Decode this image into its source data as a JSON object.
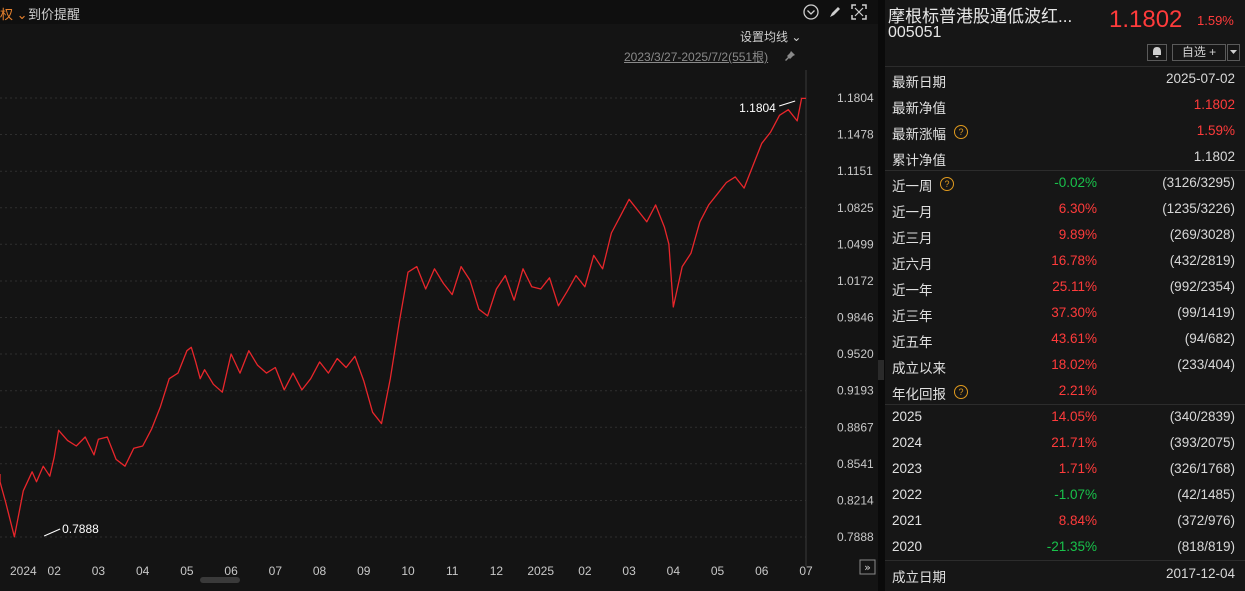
{
  "toolbar": {
    "left_fragment": "权",
    "price_alert": "到价提醒",
    "ma_setting": "设置均线",
    "range": "2023/3/27-2025/7/2(551根)"
  },
  "fund": {
    "name": "摩根标普港股通低波红...",
    "code": "005051",
    "nav": "1.1802",
    "change": "1.59%",
    "watch_label": "自选 +"
  },
  "basic_info": [
    {
      "label": "最新日期",
      "value": "2025-07-02",
      "color": "neutral"
    },
    {
      "label": "最新净值",
      "value": "1.1802",
      "color": "up"
    },
    {
      "label": "最新涨幅",
      "value": "1.59%",
      "color": "up",
      "help": true
    },
    {
      "label": "累计净值",
      "value": "1.1802",
      "color": "neutral"
    }
  ],
  "period_returns": [
    {
      "label": "近一周",
      "pct": "-0.02%",
      "rank": "(3126/3295)",
      "color": "down",
      "help": true
    },
    {
      "label": "近一月",
      "pct": "6.30%",
      "rank": "(1235/3226)",
      "color": "up"
    },
    {
      "label": "近三月",
      "pct": "9.89%",
      "rank": "(269/3028)",
      "color": "up"
    },
    {
      "label": "近六月",
      "pct": "16.78%",
      "rank": "(432/2819)",
      "color": "up"
    },
    {
      "label": "近一年",
      "pct": "25.11%",
      "rank": "(992/2354)",
      "color": "up"
    },
    {
      "label": "近三年",
      "pct": "37.30%",
      "rank": "(99/1419)",
      "color": "up"
    },
    {
      "label": "近五年",
      "pct": "43.61%",
      "rank": "(94/682)",
      "color": "up"
    },
    {
      "label": "成立以来",
      "pct": "18.02%",
      "rank": "(233/404)",
      "color": "up"
    },
    {
      "label": "年化回报",
      "pct": "2.21%",
      "rank": "",
      "color": "up",
      "help": true
    }
  ],
  "yearly_returns": [
    {
      "label": "2025",
      "pct": "14.05%",
      "rank": "(340/2839)",
      "color": "up"
    },
    {
      "label": "2024",
      "pct": "21.71%",
      "rank": "(393/2075)",
      "color": "up"
    },
    {
      "label": "2023",
      "pct": "1.71%",
      "rank": "(326/1768)",
      "color": "up"
    },
    {
      "label": "2022",
      "pct": "-1.07%",
      "rank": "(42/1485)",
      "color": "down"
    },
    {
      "label": "2021",
      "pct": "8.84%",
      "rank": "(372/976)",
      "color": "up"
    },
    {
      "label": "2020",
      "pct": "-21.35%",
      "rank": "(818/819)",
      "color": "down"
    }
  ],
  "inception": {
    "label": "成立日期",
    "value": "2017-12-04"
  },
  "colors": {
    "up": "#ff3b3b",
    "down": "#19c24b",
    "line": "#e8262b",
    "grid": "#2e2e2e",
    "text": "#d8d8d8"
  },
  "chart_data": {
    "type": "line",
    "title": "",
    "xlabel": "",
    "ylabel": "",
    "ylim": [
      0.7888,
      1.1804
    ],
    "y_ticks": [
      "1.1804",
      "1.1478",
      "1.1151",
      "1.0825",
      "1.0499",
      "1.0172",
      "0.9846",
      "0.9520",
      "0.9193",
      "0.8867",
      "0.8541",
      "0.8214",
      "0.7888"
    ],
    "x_ticks": [
      {
        "label": "2024",
        "x": 0
      },
      {
        "label": "02",
        "x": 1
      },
      {
        "label": "03",
        "x": 2
      },
      {
        "label": "04",
        "x": 3
      },
      {
        "label": "05",
        "x": 4
      },
      {
        "label": "06",
        "x": 5
      },
      {
        "label": "07",
        "x": 6
      },
      {
        "label": "08",
        "x": 7
      },
      {
        "label": "09",
        "x": 8
      },
      {
        "label": "10",
        "x": 9
      },
      {
        "label": "11",
        "x": 10
      },
      {
        "label": "12",
        "x": 11
      },
      {
        "label": "2025",
        "x": 12
      },
      {
        "label": "02",
        "x": 13
      },
      {
        "label": "03",
        "x": 14
      },
      {
        "label": "04",
        "x": 15
      },
      {
        "label": "05",
        "x": 16
      },
      {
        "label": "06",
        "x": 17
      },
      {
        "label": "07",
        "x": 18
      }
    ],
    "annotations": [
      {
        "text": "0.7888",
        "x": 0.5,
        "y": 0.7888
      },
      {
        "text": "1.1804",
        "x": 17.8,
        "y": 1.1804
      }
    ],
    "series": [
      {
        "color": "#e8262b",
        "x": [
          -0.5,
          -0.25,
          -0.1,
          0.1,
          0.3,
          0.5,
          0.6,
          0.75,
          0.9,
          1.0,
          1.1,
          1.3,
          1.5,
          1.7,
          1.9,
          2.0,
          2.2,
          2.4,
          2.6,
          2.8,
          3.0,
          3.2,
          3.4,
          3.6,
          3.8,
          4.0,
          4.1,
          4.2,
          4.3,
          4.4,
          4.6,
          4.8,
          5.0,
          5.2,
          5.4,
          5.6,
          5.8,
          6.0,
          6.2,
          6.4,
          6.6,
          6.8,
          7.0,
          7.2,
          7.4,
          7.6,
          7.8,
          8.0,
          8.2,
          8.4,
          8.5,
          8.6,
          8.8,
          9.0,
          9.2,
          9.4,
          9.6,
          9.8,
          10.0,
          10.2,
          10.4,
          10.6,
          10.8,
          11.0,
          11.2,
          11.4,
          11.6,
          11.8,
          12.0,
          12.2,
          12.4,
          12.6,
          12.8,
          13.0,
          13.2,
          13.4,
          13.6,
          13.8,
          14.0,
          14.2,
          14.4,
          14.6,
          14.8,
          14.9,
          15.0,
          15.2,
          15.4,
          15.6,
          15.8,
          16.0,
          16.2,
          16.4,
          16.6,
          16.8,
          17.0,
          17.2,
          17.4,
          17.6,
          17.8,
          17.9,
          18.0
        ],
        "values": [
          0.845,
          0.838,
          0.82,
          0.789,
          0.83,
          0.847,
          0.838,
          0.852,
          0.843,
          0.86,
          0.884,
          0.875,
          0.87,
          0.878,
          0.862,
          0.876,
          0.878,
          0.858,
          0.852,
          0.868,
          0.87,
          0.885,
          0.905,
          0.93,
          0.935,
          0.955,
          0.958,
          0.945,
          0.93,
          0.938,
          0.925,
          0.918,
          0.952,
          0.935,
          0.955,
          0.942,
          0.935,
          0.94,
          0.92,
          0.935,
          0.92,
          0.93,
          0.945,
          0.935,
          0.948,
          0.94,
          0.95,
          0.928,
          0.9,
          0.89,
          0.91,
          0.93,
          0.98,
          1.025,
          1.03,
          1.01,
          1.028,
          1.015,
          1.005,
          1.03,
          1.018,
          0.992,
          0.986,
          1.01,
          1.022,
          1.0,
          1.028,
          1.012,
          1.01,
          1.02,
          0.995,
          1.008,
          1.022,
          1.012,
          1.04,
          1.028,
          1.06,
          1.075,
          1.09,
          1.08,
          1.07,
          1.085,
          1.065,
          1.05,
          0.994,
          1.03,
          1.042,
          1.07,
          1.085,
          1.095,
          1.105,
          1.11,
          1.1,
          1.12,
          1.14,
          1.15,
          1.165,
          1.17,
          1.16,
          1.18,
          1.18
        ]
      }
    ]
  }
}
